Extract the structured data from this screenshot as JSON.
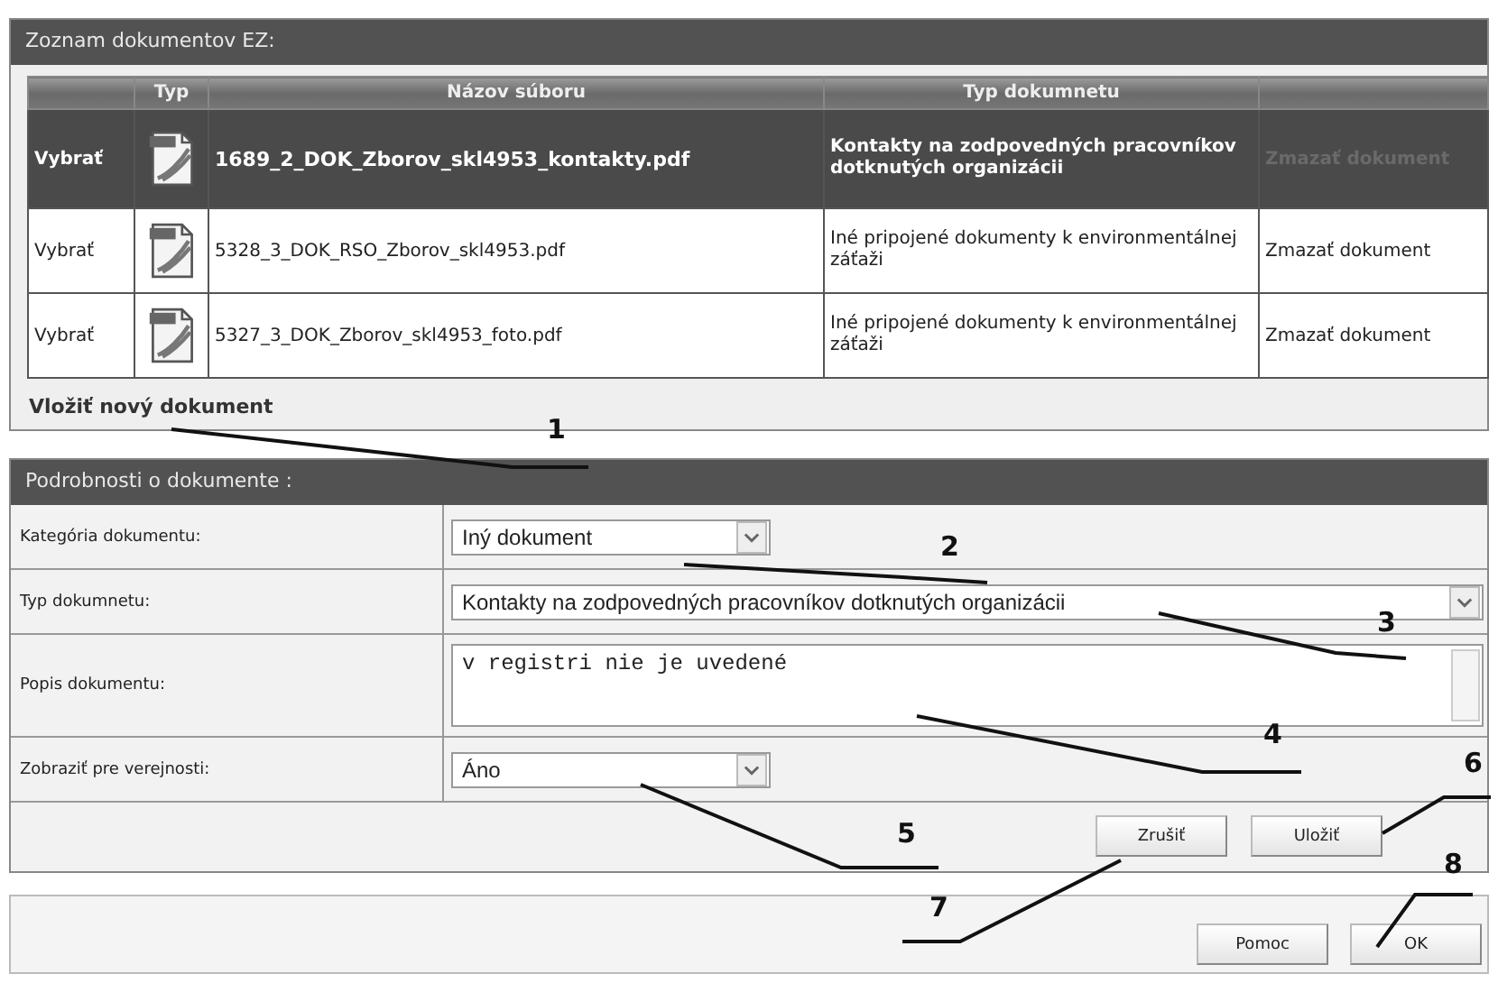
{
  "documents_panel": {
    "title": "Zoznam dokumentov EZ:",
    "columns": [
      "",
      "Typ",
      "Názov súboru",
      "Typ dokumnetu",
      ""
    ],
    "rows": [
      {
        "select": "Vybrať",
        "file_name": "1689_2_DOK_Zborov_skl4953_kontakty.pdf",
        "document_type": "Kontakty na zodpovedných pracovníkov dotknutých organizácii",
        "delete": "Zmazať dokument",
        "selected": true
      },
      {
        "select": "Vybrať",
        "file_name": "5328_3_DOK_RSO_Zborov_skl4953.pdf",
        "document_type": "Iné pripojené dokumenty k environmentálnej záťaži",
        "delete": "Zmazať dokument",
        "selected": false
      },
      {
        "select": "Vybrať",
        "file_name": "5327_3_DOK_Zborov_skl4953_foto.pdf",
        "document_type": "Iné pripojené dokumenty k environmentálnej záťaži",
        "delete": "Zmazať dokument",
        "selected": false
      }
    ],
    "add_link": "Vložiť nový dokument"
  },
  "details_panel": {
    "title": "Podrobnosti o dokumente :",
    "fields": [
      {
        "kind": "select",
        "label": "Kategória dokumentu:",
        "value": "Iný dokument",
        "wide": false
      },
      {
        "kind": "select",
        "label": "Typ dokumnetu:",
        "value": "Kontakty na zodpovedných pracovníkov dotknutých organizácii",
        "wide": true
      },
      {
        "kind": "textarea",
        "label": "Popis dokumentu:",
        "value": "v registri nie je uvedené"
      },
      {
        "kind": "select",
        "label": "Zobraziť pre verejnosti:",
        "value": "Áno",
        "wide": false
      }
    ],
    "buttons": [
      "Zrušiť",
      "Uložiť"
    ]
  },
  "footer_buttons": [
    "Pomoc",
    "OK"
  ],
  "callouts": [
    "1",
    "2",
    "3",
    "4",
    "5",
    "6",
    "7",
    "8"
  ]
}
